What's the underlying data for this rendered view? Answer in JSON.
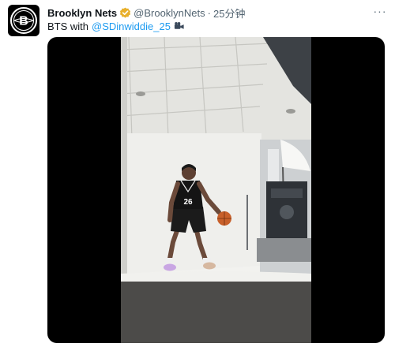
{
  "tweet": {
    "display_name": "Brooklyn Nets",
    "handle": "@BrooklynNets",
    "separator": "·",
    "time": "25分钟",
    "more": "···",
    "text_prefix": "BTS with",
    "mention": "@SDinwiddie_25",
    "avatar_letter": "B",
    "jersey_number": "26"
  },
  "colors": {
    "accent": "#1d9bf0",
    "verified_badge": "#e8b02c",
    "text_primary": "#0f1419",
    "text_secondary": "#536471"
  },
  "icons": {
    "avatar": "brooklyn-nets-logo-icon",
    "verified": "verified-badge-icon",
    "more": "more-options-icon",
    "camera": "video-camera-icon"
  }
}
